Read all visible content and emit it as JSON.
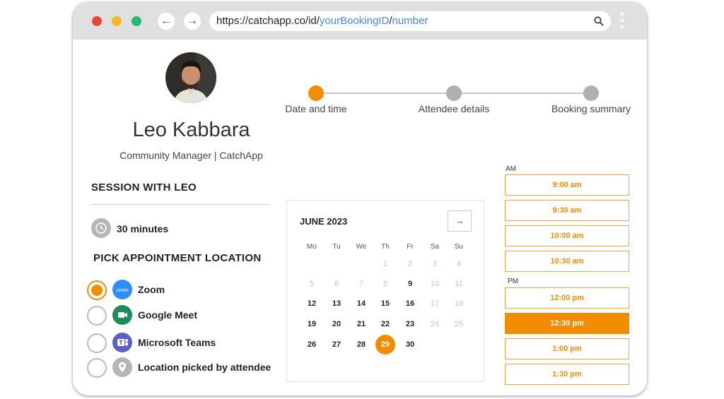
{
  "browser": {
    "url_base": "https://catchapp.co/id/",
    "url_booking": "yourBookingID",
    "url_sep": "/",
    "url_number": "number",
    "back_label": "←",
    "forward_label": "→"
  },
  "host": {
    "name": "Leo Kabbara",
    "role": "Community Manager | CatchApp"
  },
  "session": {
    "title": "SESSION WITH LEO",
    "duration": "30 minutes"
  },
  "location": {
    "title": "PICK APPOINTMENT LOCATION",
    "options": [
      {
        "label": "Zoom",
        "icon": "zoom-icon",
        "color": "#2d8cff",
        "icon_text": "zoom",
        "selected": true
      },
      {
        "label": "Google Meet",
        "icon": "google-meet-icon",
        "color": "#1f8a5e",
        "selected": false
      },
      {
        "label": "Microsoft Teams",
        "icon": "microsoft-teams-icon",
        "color": "#5b5fc7",
        "selected": false
      },
      {
        "label": "Location picked by attendee",
        "icon": "location-pin-icon",
        "color": "#b5b5b5",
        "selected": false
      }
    ]
  },
  "steps": [
    {
      "label": "Date and time",
      "active": true
    },
    {
      "label": "Attendee details",
      "active": false
    },
    {
      "label": "Booking summary",
      "active": false
    }
  ],
  "calendar": {
    "month_label": "JUNE 2023",
    "next_label": "→",
    "weekdays": [
      "Mo",
      "Tu",
      "We",
      "Th",
      "Fr",
      "Sa",
      "Su"
    ],
    "weeks": [
      [
        null,
        null,
        null,
        {
          "d": "1",
          "s": "un"
        },
        {
          "d": "2",
          "s": "un"
        },
        {
          "d": "3",
          "s": "un"
        },
        {
          "d": "4",
          "s": "un"
        }
      ],
      [
        {
          "d": "5",
          "s": "un"
        },
        {
          "d": "6",
          "s": "un"
        },
        {
          "d": "7",
          "s": "un"
        },
        {
          "d": "8",
          "s": "un"
        },
        {
          "d": "9",
          "s": "av"
        },
        {
          "d": "10",
          "s": "un"
        },
        {
          "d": "11",
          "s": "un"
        }
      ],
      [
        {
          "d": "12",
          "s": "av"
        },
        {
          "d": "13",
          "s": "av"
        },
        {
          "d": "14",
          "s": "av"
        },
        {
          "d": "15",
          "s": "av"
        },
        {
          "d": "16",
          "s": "av"
        },
        {
          "d": "17",
          "s": "un"
        },
        {
          "d": "18",
          "s": "un"
        }
      ],
      [
        {
          "d": "19",
          "s": "av"
        },
        {
          "d": "20",
          "s": "av"
        },
        {
          "d": "21",
          "s": "av"
        },
        {
          "d": "22",
          "s": "av"
        },
        {
          "d": "23",
          "s": "av"
        },
        {
          "d": "24",
          "s": "un"
        },
        {
          "d": "25",
          "s": "un"
        }
      ],
      [
        {
          "d": "26",
          "s": "av"
        },
        {
          "d": "27",
          "s": "av"
        },
        {
          "d": "28",
          "s": "av"
        },
        {
          "d": "29",
          "s": "sel"
        },
        {
          "d": "30",
          "s": "av"
        },
        null,
        null
      ]
    ]
  },
  "times": {
    "am_label": "AM",
    "pm_label": "PM",
    "am": [
      {
        "label": "9:00 am",
        "selected": false
      },
      {
        "label": "9:30 am",
        "selected": false
      },
      {
        "label": "10:00 am",
        "selected": false
      },
      {
        "label": "10:30 am",
        "selected": false
      }
    ],
    "pm": [
      {
        "label": "12:00 pm",
        "selected": false
      },
      {
        "label": "12:30 pm",
        "selected": true
      },
      {
        "label": "1:00 pm",
        "selected": false
      },
      {
        "label": "1:30 pm",
        "selected": false
      }
    ]
  },
  "colors": {
    "accent": "#f28c00",
    "traffic_red": "#e8453c",
    "traffic_yellow": "#f5b921",
    "traffic_green": "#2bb673"
  }
}
